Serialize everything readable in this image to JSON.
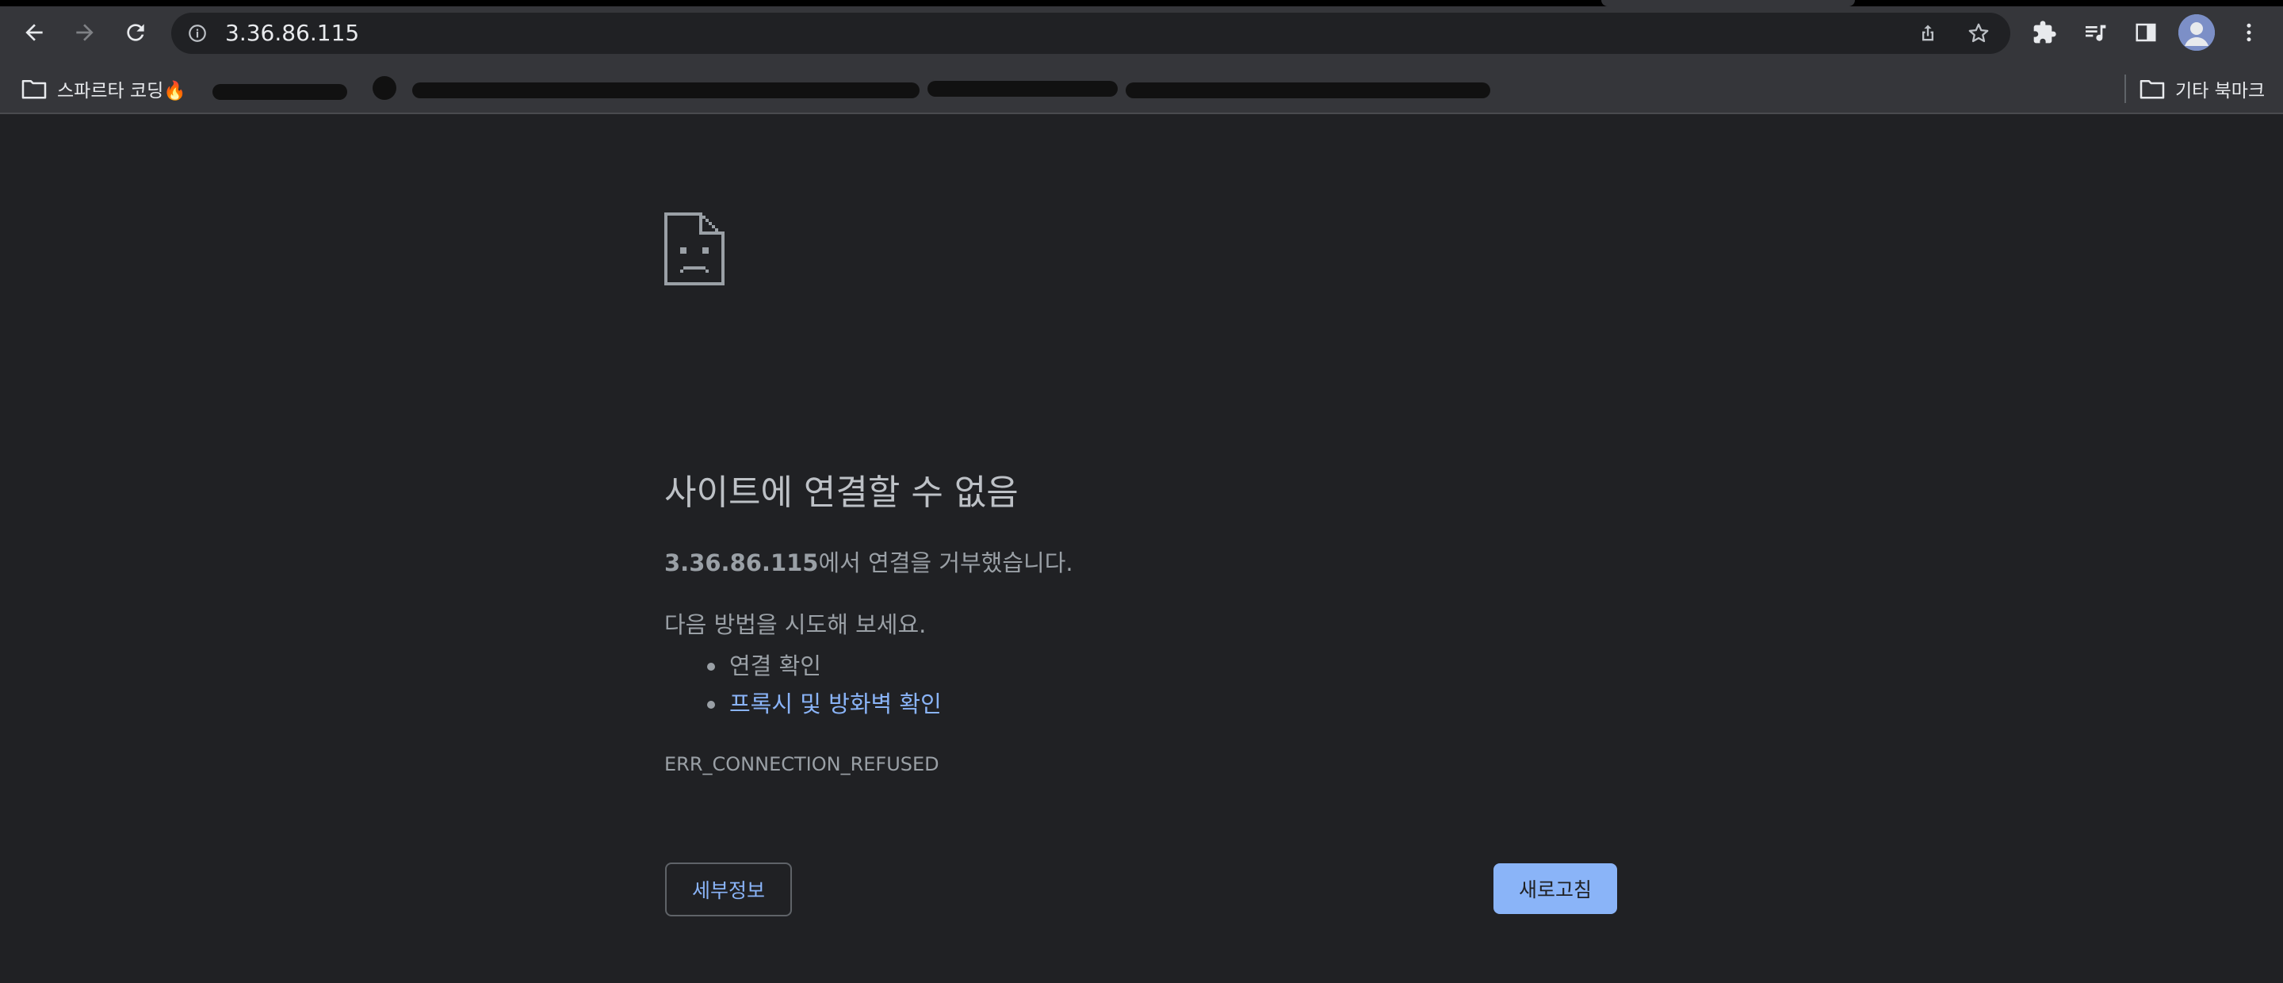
{
  "toolbar": {
    "url": "3.36.86.115",
    "back_icon": "back-arrow-icon",
    "forward_icon": "forward-arrow-icon",
    "reload_icon": "reload-icon"
  },
  "bookmarks": {
    "first_label": "스파르타 코딩🔥",
    "other_label": "기타 북마크"
  },
  "error": {
    "title": "사이트에 연결할 수 없음",
    "host": "3.36.86.115",
    "desc_suffix": "에서 연결을 거부했습니다.",
    "suggest_intro": "다음 방법을 시도해 보세요.",
    "suggestions": [
      "연결 확인",
      "프록시 및 방화벽 확인"
    ],
    "code": "ERR_CONNECTION_REFUSED",
    "details_label": "세부정보",
    "reload_label": "새로고침"
  },
  "colors": {
    "page_bg": "#202124",
    "toolbar_bg": "#35363a",
    "link": "#8ab4f8",
    "text": "#9aa0a6"
  }
}
